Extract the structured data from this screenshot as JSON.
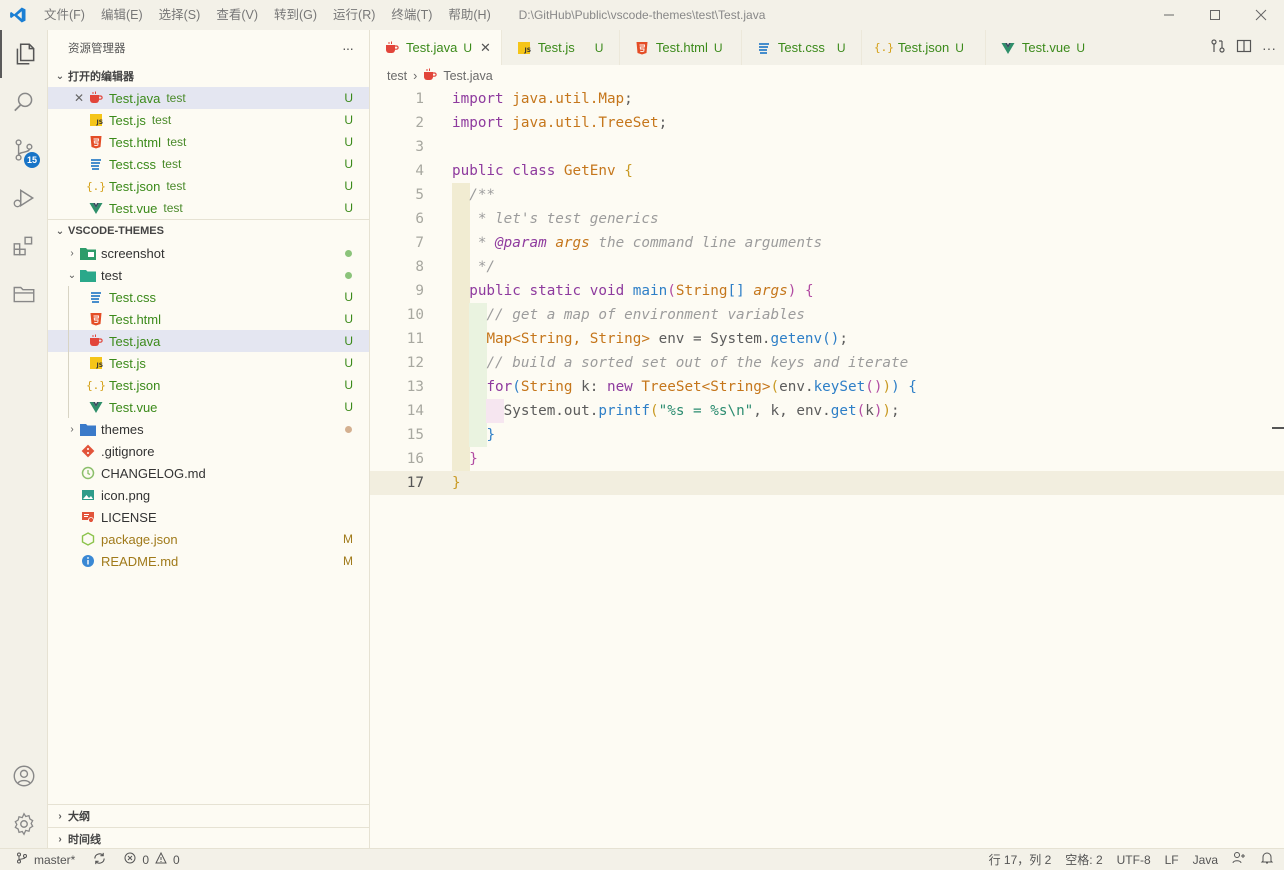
{
  "titlebar": {
    "menus": [
      "文件(F)",
      "编辑(E)",
      "选择(S)",
      "查看(V)",
      "转到(G)",
      "运行(R)",
      "终端(T)",
      "帮助(H)"
    ],
    "window_title": "D:\\GitHub\\Public\\vscode-themes\\test\\Test.java"
  },
  "activity": {
    "scm_badge": "15"
  },
  "sidebar": {
    "title": "资源管理器",
    "more": "···",
    "open_editors_title": "打开的编辑器",
    "open_editors": [
      {
        "name": "Test.java",
        "desc": "test",
        "status": "U",
        "icon": "java-icon",
        "color": "#e44d26"
      },
      {
        "name": "Test.js",
        "desc": "test",
        "status": "U",
        "icon": "js-icon",
        "color": "#f5c518"
      },
      {
        "name": "Test.html",
        "desc": "test",
        "status": "U",
        "icon": "html-icon",
        "color": "#e44d26"
      },
      {
        "name": "Test.css",
        "desc": "test",
        "status": "U",
        "icon": "css-icon",
        "color": "#2e7fc7"
      },
      {
        "name": "Test.json",
        "desc": "test",
        "status": "U",
        "icon": "json-icon",
        "color": "#d4a017"
      },
      {
        "name": "Test.vue",
        "desc": "test",
        "status": "U",
        "icon": "vue-icon",
        "color": "#2e8f6a"
      }
    ],
    "project_title": "VSCODE-THEMES",
    "folders": {
      "screenshot": "screenshot",
      "test": "test",
      "themes": "themes"
    },
    "test_files": [
      {
        "name": "Test.css",
        "status": "U",
        "icon": "css-icon"
      },
      {
        "name": "Test.html",
        "status": "U",
        "icon": "html-icon"
      },
      {
        "name": "Test.java",
        "status": "U",
        "icon": "java-icon"
      },
      {
        "name": "Test.js",
        "status": "U",
        "icon": "js-icon"
      },
      {
        "name": "Test.json",
        "status": "U",
        "icon": "json-icon"
      },
      {
        "name": "Test.vue",
        "status": "U",
        "icon": "vue-icon"
      }
    ],
    "root_files": [
      {
        "name": ".gitignore",
        "status": "",
        "icon": "git-icon"
      },
      {
        "name": "CHANGELOG.md",
        "status": "",
        "icon": "changelog-icon"
      },
      {
        "name": "icon.png",
        "status": "",
        "icon": "image-icon"
      },
      {
        "name": "LICENSE",
        "status": "",
        "icon": "license-icon"
      },
      {
        "name": "package.json",
        "status": "M",
        "icon": "nodejs-icon"
      },
      {
        "name": "README.md",
        "status": "M",
        "icon": "info-icon"
      }
    ],
    "outline_title": "大纲",
    "timeline_title": "时间线"
  },
  "tabs": [
    {
      "name": "Test.java",
      "status": "U",
      "close": "✕"
    },
    {
      "name": "Test.js",
      "status": "U"
    },
    {
      "name": "Test.html",
      "status": "U"
    },
    {
      "name": "Test.css",
      "status": "U"
    },
    {
      "name": "Test.json",
      "status": "U"
    },
    {
      "name": "Test.vue",
      "status": "U"
    }
  ],
  "breadcrumb": {
    "folder": "test",
    "file": "Test.java"
  },
  "code": {
    "line_numbers": [
      "1",
      "2",
      "3",
      "4",
      "5",
      "6",
      "7",
      "8",
      "9",
      "10",
      "11",
      "12",
      "13",
      "14",
      "15",
      "16",
      "17"
    ]
  },
  "statusbar": {
    "branch": "master*",
    "errors": "0",
    "warnings": "0",
    "position": "行 17，列 2",
    "spaces": "空格: 2",
    "encoding": "UTF-8",
    "eol": "LF",
    "language": "Java"
  }
}
